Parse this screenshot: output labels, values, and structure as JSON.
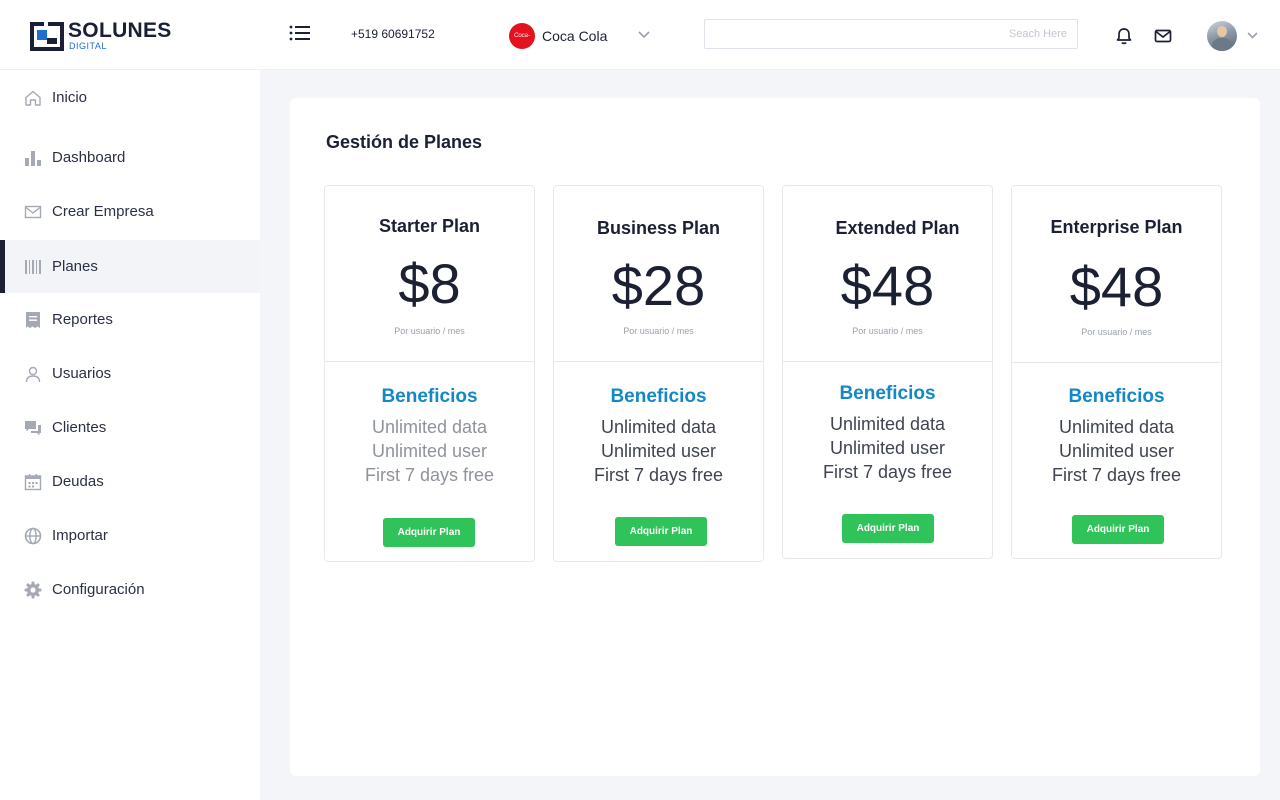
{
  "brand": {
    "name": "SOLUNES",
    "sub": "DIGITAL"
  },
  "header": {
    "phone": "+519 60691752",
    "company": {
      "name": "Coca Cola",
      "logo_text": "Coca-Cola",
      "logo_color": "#e4121e"
    },
    "search": {
      "placeholder": "Seach Here",
      "value": ""
    },
    "icons": [
      "menu-icon",
      "bell-icon",
      "mail-icon",
      "avatar",
      "chevron-down-icon"
    ]
  },
  "sidebar": {
    "items": [
      {
        "label": "Inicio",
        "icon": "home-icon"
      },
      {
        "label": "Dashboard",
        "icon": "bar-chart-icon"
      },
      {
        "label": "Crear Empresa",
        "icon": "envelope-icon"
      },
      {
        "label": "Planes",
        "icon": "barcode-icon",
        "active": true
      },
      {
        "label": "Reportes",
        "icon": "receipt-icon"
      },
      {
        "label": "Usuarios",
        "icon": "user-icon"
      },
      {
        "label": "Clientes",
        "icon": "chat-icon"
      },
      {
        "label": "Deudas",
        "icon": "calendar-icon"
      },
      {
        "label": "Importar",
        "icon": "globe-icon"
      },
      {
        "label": "Configuración",
        "icon": "gear-icon"
      }
    ]
  },
  "main": {
    "title": "Gestión de Planes",
    "plans": [
      {
        "name": "Starter Plan",
        "price": "$8",
        "per": "Por usuario / mes",
        "benefits_title": "Beneficios",
        "features": [
          "Unlimited data",
          "Unlimited user",
          "First 7 days free"
        ],
        "button": "Adquirir Plan",
        "feature_color": "#8f939c"
      },
      {
        "name": "Business Plan",
        "price": "$28",
        "per": "Por usuario / mes",
        "benefits_title": "Beneficios",
        "features": [
          "Unlimited data",
          "Unlimited user",
          "First 7 days free"
        ],
        "button": "Adquirir Plan",
        "feature_color": "#3f4450"
      },
      {
        "name": "Extended Plan",
        "price": "$48",
        "per": "Por usuario / mes",
        "benefits_title": "Beneficios",
        "features": [
          "Unlimited data",
          "Unlimited user",
          "First 7 days free"
        ],
        "button": "Adquirir Plan",
        "feature_color": "#3f4450"
      },
      {
        "name": "Enterprise Plan",
        "price": "$48",
        "per": "Por usuario / mes",
        "benefits_title": "Beneficios",
        "features": [
          "Unlimited data",
          "Unlimited user",
          "First 7 days free"
        ],
        "button": "Adquirir Plan",
        "feature_color": "#3f4450"
      }
    ]
  },
  "colors": {
    "accent_blue": "#1488c6",
    "button_green": "#2fc35a",
    "sidebar_active_bar": "#1b2033"
  }
}
